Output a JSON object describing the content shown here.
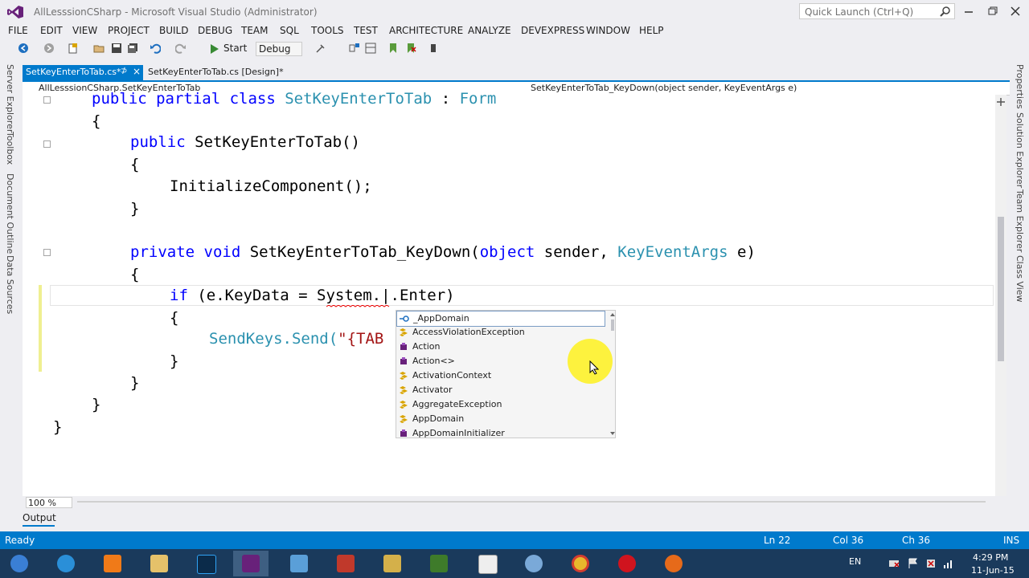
{
  "window": {
    "title": "AllLesssionCSharp - Microsoft Visual Studio (Administrator)",
    "quick_launch_placeholder": "Quick Launch (Ctrl+Q)"
  },
  "menu": [
    "FILE",
    "EDIT",
    "VIEW",
    "PROJECT",
    "BUILD",
    "DEBUG",
    "TEAM",
    "SQL",
    "TOOLS",
    "TEST",
    "ARCHITECTURE",
    "ANALYZE",
    "DEVEXPRESS",
    "WINDOW",
    "HELP"
  ],
  "toolbar": {
    "start_label": "Start",
    "config": "Debug"
  },
  "left_rail": [
    "Server Explorer",
    "Toolbox",
    "Document Outline",
    "Data Sources"
  ],
  "right_rail": [
    "Properties",
    "Solution Explorer",
    "Team Explorer",
    "Class View"
  ],
  "tabs": {
    "active": "SetKeyEnterToTab.cs*",
    "active_pin": "⊅",
    "close": "×",
    "design": "SetKeyEnterToTab.cs [Design]*"
  },
  "nav": {
    "left": "AllLesssionCSharp.SetKeyEnterToTab",
    "right": "SetKeyEnterToTab_KeyDown(object sender, KeyEventArgs e)"
  },
  "code": {
    "l1_kw": "public partial class ",
    "l1_ty": "SetKeyEnterToTab",
    "l1_rest": " : ",
    "l1_ty2": "Form",
    "brace_open": "{",
    "brace_close": "}",
    "l3_kw": "public ",
    "l3_rest": "SetKeyEnterToTab()",
    "l5": "InitializeComponent();",
    "l8_kw": "private void ",
    "l8_rest": "SetKeyEnterToTab_KeyDown(",
    "l8_kw2": "object",
    "l8_rest2": " sender, ",
    "l8_ty": "KeyEventArgs",
    "l8_rest3": " e)",
    "l10_kw": "if ",
    "l10_rest": "(e.KeyData = System.|.Enter)",
    "l12_a": "SendKeys.Send(",
    "l12_st": "\"{TAB"
  },
  "intellisense": [
    "_AppDomain",
    "AccessViolationException",
    "Action",
    "Action<>",
    "ActivationContext",
    "Activator",
    "AggregateException",
    "AppDomain",
    "AppDomainInitializer"
  ],
  "zoom": "100 %",
  "output_tab": "Output",
  "status": {
    "ready": "Ready",
    "ln": "Ln 22",
    "col": "Col 36",
    "ch": "Ch 36",
    "ins": "INS"
  },
  "taskbar": {
    "lang": "EN",
    "time": "4:29 PM",
    "date": "11-Jun-15"
  },
  "colors": {
    "accent": "#007acc",
    "keyword": "#0000ff",
    "type": "#2b91af",
    "string": "#a31515"
  }
}
